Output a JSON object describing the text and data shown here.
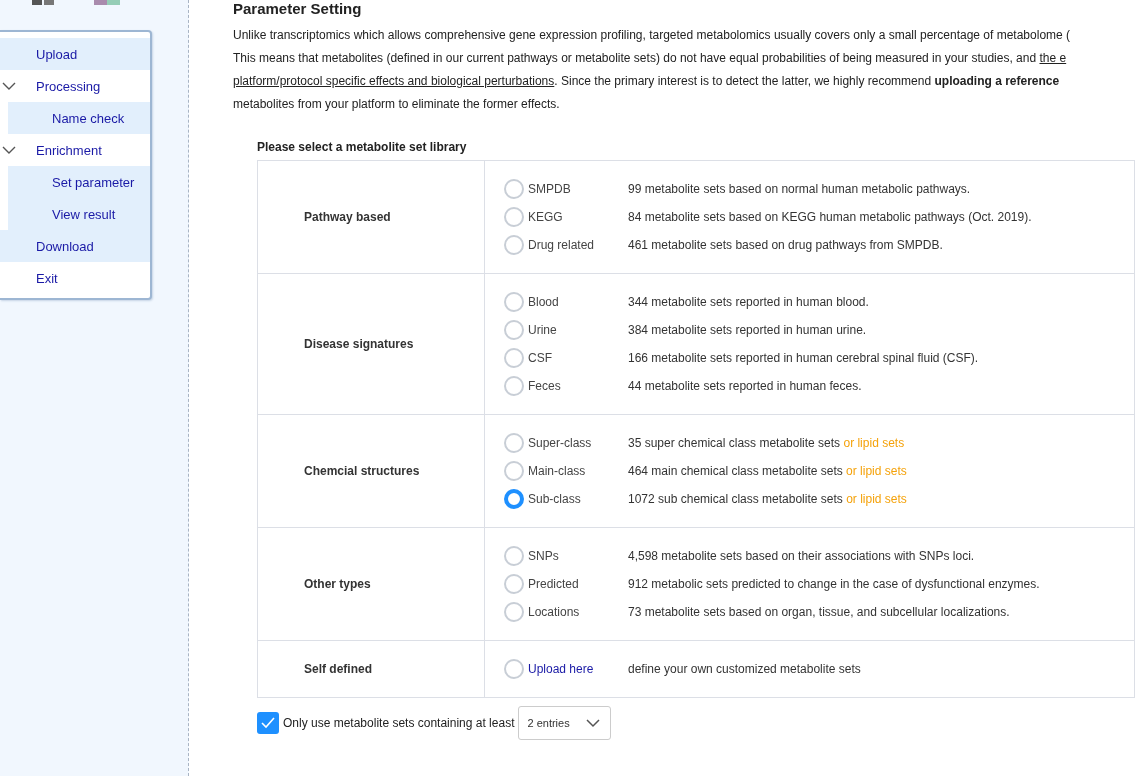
{
  "menu": [
    {
      "label": "Upload",
      "kind": "item"
    },
    {
      "label": "Processing",
      "kind": "group",
      "expanded": true,
      "children": [
        {
          "label": "Name check"
        }
      ]
    },
    {
      "label": "Enrichment",
      "kind": "group",
      "expanded": true,
      "children": [
        {
          "label": "Set parameter"
        },
        {
          "label": "View result"
        }
      ]
    },
    {
      "label": "Download",
      "kind": "item"
    },
    {
      "label": "Exit",
      "kind": "item"
    }
  ],
  "page_title": "Parameter Setting",
  "intro_lines": [
    [
      {
        "kind": "plain",
        "text": "Unlike transcriptomics which allows comprehensive gene expression profiling, targeted metabolomics usually covers only a small percentage of metabolome ("
      }
    ],
    [
      {
        "kind": "plain",
        "text": "This means that metabolites (defined in our current pathways or metabolite sets) do not have equal probabilities of being measured in your studies, and "
      },
      {
        "kind": "link",
        "text": "the e"
      }
    ],
    [
      {
        "kind": "link",
        "text": "platform/protocol specific effects and biological perturbations"
      },
      {
        "kind": "plain",
        "text": ". Since the primary interest is to detect the latter, we highly recommend "
      },
      {
        "kind": "bold",
        "text": "uploading a reference"
      }
    ],
    [
      {
        "kind": "plain",
        "text": "metabolites from your platform to eliminate the former effects."
      }
    ]
  ],
  "library_heading": "Please select a metabolite set library",
  "groups": [
    {
      "name": "Pathway based",
      "options": [
        {
          "label": "SMPDB",
          "kind": "option",
          "selected": false,
          "description": "99 metabolite sets based on normal human metabolic pathways."
        },
        {
          "label": "KEGG",
          "kind": "option",
          "selected": false,
          "description": "84 metabolite sets based on KEGG human metabolic pathways (Oct. 2019)."
        },
        {
          "label": "Drug related",
          "kind": "option",
          "selected": false,
          "description": "461 metabolite sets based on drug pathways from SMPDB."
        }
      ]
    },
    {
      "name": "Disease signatures",
      "options": [
        {
          "label": "Blood",
          "kind": "option",
          "selected": false,
          "description": "344 metabolite sets reported in human blood."
        },
        {
          "label": "Urine",
          "kind": "option",
          "selected": false,
          "description": "384 metabolite sets reported in human urine."
        },
        {
          "label": "CSF",
          "kind": "option",
          "selected": false,
          "description": "166 metabolite sets reported in human cerebral spinal fluid (CSF)."
        },
        {
          "label": "Feces",
          "kind": "option",
          "selected": false,
          "description": "44 metabolite sets reported in human feces."
        }
      ]
    },
    {
      "name": "Chemcial structures",
      "options": [
        {
          "label": "Super-class",
          "kind": "option",
          "selected": false,
          "description": "35 super chemical class metabolite sets",
          "extra_link": "or lipid sets"
        },
        {
          "label": "Main-class",
          "kind": "option",
          "selected": false,
          "description": "464 main chemical class metabolite sets",
          "extra_link": "or lipid sets"
        },
        {
          "label": "Sub-class",
          "kind": "option",
          "selected": true,
          "description": "1072 sub chemical class metabolite sets",
          "extra_link": "or lipid sets"
        }
      ]
    },
    {
      "name": "Other types",
      "options": [
        {
          "label": "SNPs",
          "kind": "option",
          "selected": false,
          "description": "4,598 metabolite sets based on their associations with SNPs loci."
        },
        {
          "label": "Predicted",
          "kind": "option",
          "selected": false,
          "description": "912 metabolic sets predicted to change in the case of dysfunctional enzymes."
        },
        {
          "label": "Locations",
          "kind": "option",
          "selected": false,
          "description": "73 metabolite sets based on organ, tissue, and subcellular localizations."
        }
      ]
    },
    {
      "name": "Self defined",
      "options": [
        {
          "label": "Upload here",
          "kind": "link",
          "selected": false,
          "description": "define your own customized metabolite sets"
        }
      ]
    }
  ],
  "min_entries": {
    "checked": true,
    "label": "Only use metabolite sets containing at least",
    "value": "2 entries"
  }
}
